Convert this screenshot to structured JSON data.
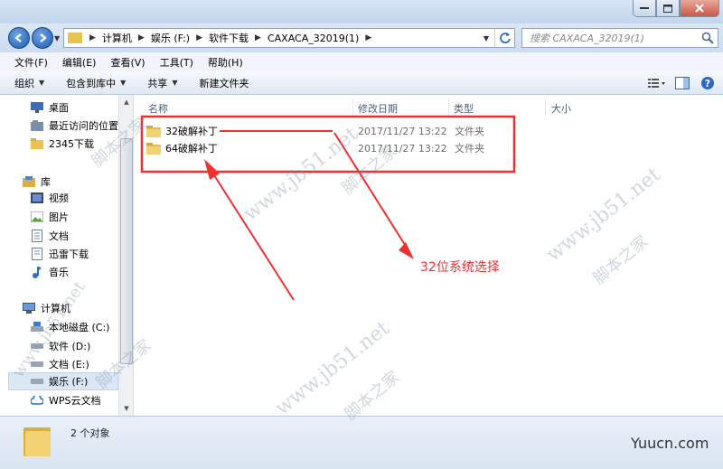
{
  "window": {
    "controls": [
      "minimize-icon",
      "maximize-icon",
      "close-icon"
    ]
  },
  "address": {
    "crumbs": [
      "计算机",
      "娱乐 (F:)",
      "软件下载",
      "CAXACA_32019(1)"
    ]
  },
  "search": {
    "placeholder": "搜索 CAXACA_32019(1)"
  },
  "menu": [
    "文件(F)",
    "编辑(E)",
    "查看(V)",
    "工具(T)",
    "帮助(H)"
  ],
  "toolbar": {
    "organize": "组织",
    "include_in_library": "包含到库中",
    "share": "共享",
    "new_folder": "新建文件夹"
  },
  "sidebar": {
    "items": [
      "桌面",
      "最近访问的位置",
      "2345下载",
      "库",
      "视频",
      "图片",
      "文档",
      "迅雷下载",
      "音乐",
      "计算机",
      "本地磁盘 (C:)",
      "软件 (D:)",
      "文档 (E:)",
      "娱乐 (F:)",
      "WPS云文档"
    ]
  },
  "columns": {
    "name": "名称",
    "date": "修改日期",
    "type": "类型",
    "size": "大小"
  },
  "files": [
    {
      "name": "32破解补丁",
      "date": "2017/11/27 13:22",
      "type": "文件夹"
    },
    {
      "name": "64破解补丁",
      "date": "2017/11/27 13:22",
      "type": "文件夹"
    }
  ],
  "annotation": {
    "text": "32位系统选择",
    "color": "#ee3030"
  },
  "watermark": {
    "url": "www.jb51.net",
    "name": "脚本之家"
  },
  "status": {
    "count": "2 个对象"
  },
  "brand": "Yuucn.com"
}
